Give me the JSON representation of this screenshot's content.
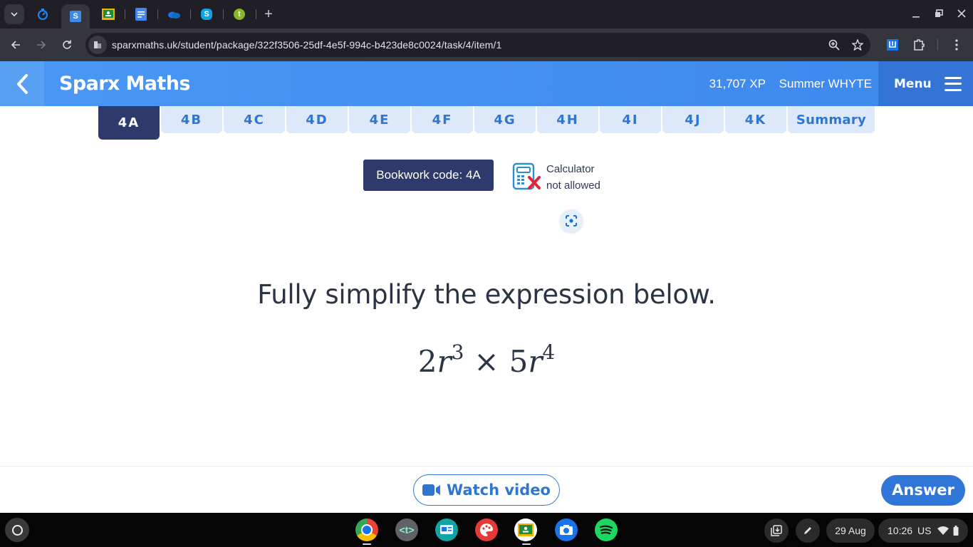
{
  "browser": {
    "tabs": [
      {
        "name": "timer",
        "icon": "stopwatch-icon",
        "active": false
      },
      {
        "name": "sparx",
        "icon": "sparx-s-icon",
        "label": "S",
        "active": true
      },
      {
        "name": "classroom",
        "icon": "google-classroom-icon",
        "active": false
      },
      {
        "name": "docs",
        "icon": "google-docs-icon",
        "active": false
      },
      {
        "name": "onedrive",
        "icon": "onedrive-icon",
        "active": false
      },
      {
        "name": "skype",
        "icon": "skype-icon",
        "label": "S",
        "active": false
      },
      {
        "name": "tassomai",
        "icon": "t-icon",
        "label": "t",
        "active": false
      }
    ],
    "new_tab_label": "+",
    "url": "sparxmaths.uk/student/package/322f3506-25df-4e5f-994c-b423de8c0024/task/4/item/1"
  },
  "header": {
    "brand": "Sparx Maths",
    "xp": "31,707 XP",
    "user_name": "Summer WHYTE",
    "menu_label": "Menu"
  },
  "task_tabs": [
    {
      "label": "4A",
      "active": true
    },
    {
      "label": "4B",
      "active": false
    },
    {
      "label": "4C",
      "active": false
    },
    {
      "label": "4D",
      "active": false
    },
    {
      "label": "4E",
      "active": false
    },
    {
      "label": "4F",
      "active": false
    },
    {
      "label": "4G",
      "active": false
    },
    {
      "label": "4H",
      "active": false
    },
    {
      "label": "4I",
      "active": false
    },
    {
      "label": "4J",
      "active": false
    },
    {
      "label": "4K",
      "active": false
    },
    {
      "label": "Summary",
      "active": false
    }
  ],
  "bookwork": {
    "label": "Bookwork code: 4A"
  },
  "calculator": {
    "line1": "Calculator",
    "line2": "not allowed"
  },
  "question": {
    "prompt": "Fully simplify the expression below.",
    "expression": {
      "term1_coef": "2",
      "term1_var": "r",
      "term1_exp": "3",
      "operator": "×",
      "term2_coef": "5",
      "term2_var": "r",
      "term2_exp": "4"
    }
  },
  "footer": {
    "watch_video_label": "Watch video",
    "answer_label": "Answer"
  },
  "shelf": {
    "apps": [
      "chrome",
      "text-editor",
      "news-app",
      "paint",
      "google-classroom",
      "camera",
      "spotify"
    ],
    "date": "29 Aug",
    "time": "10:26",
    "locale": "US"
  },
  "colors": {
    "brand_blue": "#3d8bf0",
    "navy": "#2d3a6b",
    "tab_bg": "#dde9f8",
    "tab_text": "#2f76d0",
    "answer_blue": "#2f76d8",
    "calc_cross": "#e0263d"
  }
}
